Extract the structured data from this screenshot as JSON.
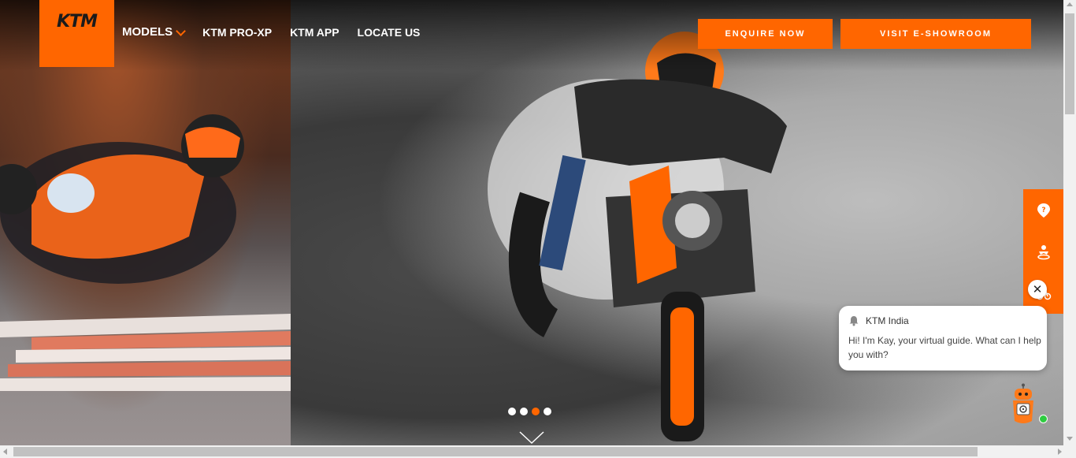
{
  "brand": {
    "logo_text": "KTM",
    "accent_color": "#ff6600"
  },
  "nav": {
    "items": [
      {
        "label": "MODELS",
        "has_dropdown": true
      },
      {
        "label": "KTM PRO-XP"
      },
      {
        "label": "KTM APP"
      },
      {
        "label": "LOCATE US"
      }
    ]
  },
  "cta": {
    "enquire": "ENQUIRE NOW",
    "visit": "VISIT E-SHOWROOM"
  },
  "side_widget": {
    "icons": [
      "question-pin-icon",
      "rider-icon",
      "bike-icon"
    ]
  },
  "chat": {
    "title": "KTM India",
    "message": "Hi! I'm Kay, your virtual guide. What can I help you with?"
  },
  "carousel": {
    "slides": 4,
    "active_index": 2
  }
}
